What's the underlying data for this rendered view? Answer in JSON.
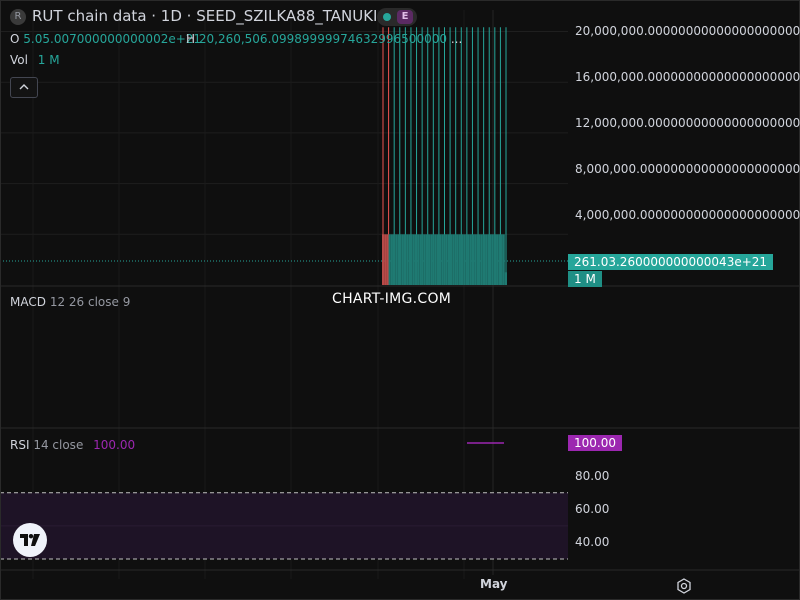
{
  "header": {
    "symbol_icon": "R",
    "title": "RUT chain data · 1D · SEED_SZILKA88_TANUKI",
    "exchange_badge": "E",
    "o_label": "O",
    "o_value": "5.05.007000000000002e+21",
    "h_label": "H",
    "h_value": "20,260,506.09989999974632996500000",
    "ellipsis": "...",
    "vol_label": "Vol",
    "vol_value": "1 M",
    "collapse_icon": "chevron-up-icon"
  },
  "watermark": "CHART-IMG.COM",
  "price_axis": {
    "labels": [
      "20,000,000.0000000000000000000000",
      "16,000,000.0000000000000000000000",
      "12,000,000.0000000000000000000000",
      "8,000,000.00000000000000000000000",
      "4,000,000.00000000000000000000000"
    ],
    "last_price_tag": "261.03.260000000000043e+21",
    "volume_tag": "1 M"
  },
  "macd": {
    "title": "MACD",
    "params": "12 26 close 9"
  },
  "rsi": {
    "title": "RSI",
    "params": "14 close",
    "value": "100.00",
    "tag": "100.00",
    "axis_labels": [
      "80.00",
      "60.00",
      "40.00"
    ]
  },
  "time_axis": {
    "month": "May"
  },
  "colors": {
    "up": "#26a69a",
    "down": "#ef5350",
    "rsi": "#9c27b0",
    "background": "#0f0f0f"
  },
  "chart_data": {
    "type": "bar",
    "title": "RUT chain data · 1D · SEED_SZILKA88_TANUKI",
    "ylim": [
      0,
      20000000
    ],
    "grid": true,
    "x_axis_labels": [
      "May"
    ],
    "series": [
      {
        "name": "Vol",
        "values": [
          4000000,
          4000000,
          4000000,
          4000000,
          4000000,
          4000000,
          4000000,
          4000000,
          4000000,
          4000000,
          4000000,
          4000000,
          4000000,
          4000000,
          4000000,
          4000000,
          4000000,
          4000000,
          4000000,
          4000000,
          4000000,
          4000000,
          4000000,
          4000000,
          4000000,
          4000000,
          4000000,
          4000000,
          4000000,
          4000000,
          4000000,
          4000000,
          4000000,
          4000000,
          4000000,
          4000000,
          4000000,
          4000000,
          4000000,
          4000000,
          4000000,
          4000000,
          4000000,
          4000000,
          4000000,
          4000000,
          4000000,
          4000000,
          4000000,
          4000000,
          4000000,
          4000000,
          4000000,
          4000000,
          4000000,
          4000000,
          1000000
        ]
      },
      {
        "name": "RSI",
        "values": [
          100,
          100,
          100,
          100,
          100,
          100,
          100,
          100,
          100,
          100,
          100,
          100,
          100,
          100,
          100,
          100,
          100,
          100,
          100,
          100,
          100,
          100,
          100,
          100,
          100,
          100,
          100,
          100,
          100,
          100,
          100,
          100,
          100,
          100,
          100,
          100,
          100,
          100,
          100,
          100,
          100,
          100,
          100,
          100,
          100,
          100,
          100,
          100,
          100,
          100,
          100,
          100,
          100,
          100,
          100,
          100,
          100
        ]
      }
    ],
    "down_count": 3,
    "wick_high_values": [
      20260506,
      20260506,
      20260506,
      20260506,
      20260506,
      20260506,
      20260506,
      20260506,
      20260506,
      20260506,
      20260506,
      20260506,
      20260506,
      20260506,
      20260506,
      20260506,
      20260506,
      20260506,
      20260506,
      20260506,
      20260506,
      20260506,
      20260506
    ],
    "rsi_bands": [
      30,
      70
    ],
    "rsi_ylim": [
      30,
      100
    ]
  }
}
